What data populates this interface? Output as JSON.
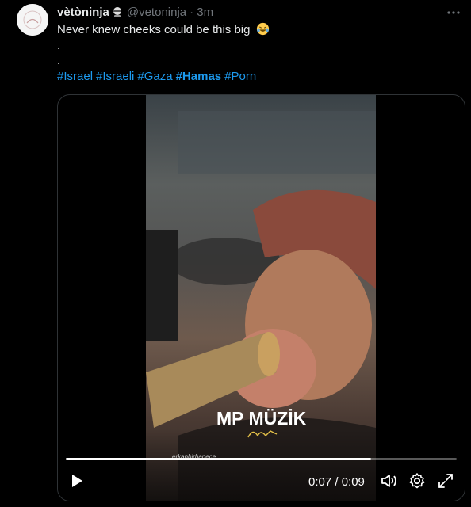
{
  "tweet": {
    "display_name": "vètòninja",
    "handle": "@vetoninja",
    "time": "· 3m",
    "text_line1": "Never knew cheeks could be this big",
    "line2": ".",
    "line3": ".",
    "hashtags": [
      "#Israel",
      "#Israeli",
      "#Gaza",
      "#Hamas",
      "#Porn"
    ]
  },
  "video": {
    "watermark": "MP MÜZİK",
    "credit": "erkanbirhanece",
    "time_display": "0:07 / 0:09",
    "progress_fraction": 0.78
  },
  "colors": {
    "link": "#1d9bf0",
    "text": "#e7e9ea",
    "muted": "#71767b",
    "border": "#2f3336"
  },
  "icons": [
    "more-icon",
    "laughing-crying-emoji-icon",
    "play-icon",
    "volume-icon",
    "settings-icon",
    "fullscreen-icon"
  ]
}
